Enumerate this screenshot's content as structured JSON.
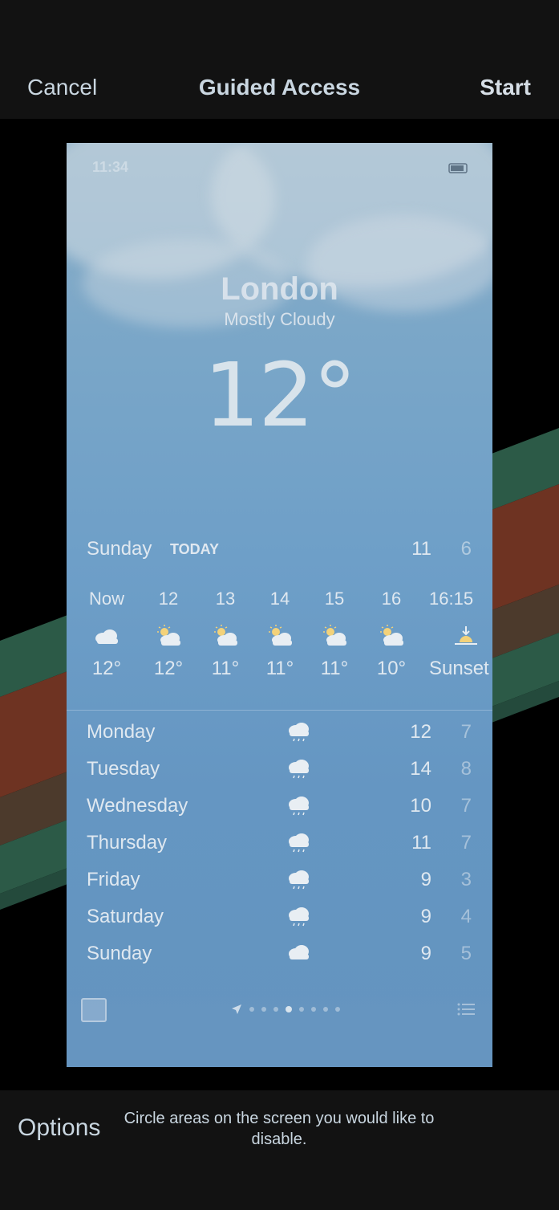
{
  "topbar": {
    "cancel": "Cancel",
    "title": "Guided Access",
    "start": "Start"
  },
  "weather": {
    "status_time": "11:34",
    "city": "London",
    "condition": "Mostly Cloudy",
    "temperature": "12°",
    "today": {
      "day": "Sunday",
      "tag": "TODAY",
      "high": "11",
      "low": "6"
    },
    "hourly": [
      {
        "time": "Now",
        "icon": "cloud-icon",
        "temp": "12°"
      },
      {
        "time": "12",
        "icon": "partly-sunny-icon",
        "temp": "12°"
      },
      {
        "time": "13",
        "icon": "partly-sunny-icon",
        "temp": "11°"
      },
      {
        "time": "14",
        "icon": "partly-sunny-icon",
        "temp": "11°"
      },
      {
        "time": "15",
        "icon": "partly-sunny-icon",
        "temp": "11°"
      },
      {
        "time": "16",
        "icon": "partly-sunny-icon",
        "temp": "10°"
      },
      {
        "time": "16:15",
        "icon": "sunset-icon",
        "temp": "Sunset"
      }
    ],
    "daily": [
      {
        "day": "Monday",
        "icon": "rain-icon",
        "high": "12",
        "low": "7"
      },
      {
        "day": "Tuesday",
        "icon": "rain-icon",
        "high": "14",
        "low": "8"
      },
      {
        "day": "Wednesday",
        "icon": "rain-icon",
        "high": "10",
        "low": "7"
      },
      {
        "day": "Thursday",
        "icon": "rain-icon",
        "high": "11",
        "low": "7"
      },
      {
        "day": "Friday",
        "icon": "rain-icon",
        "high": "9",
        "low": "3"
      },
      {
        "day": "Saturday",
        "icon": "rain-icon",
        "high": "9",
        "low": "4"
      },
      {
        "day": "Sunday",
        "icon": "cloud-icon",
        "high": "9",
        "low": "5"
      }
    ]
  },
  "optbar": {
    "options": "Options",
    "hint": "Circle areas on the screen you would like to disable."
  },
  "colors": {
    "bar_bg": "#121212",
    "stripe_green": "#2c5a47",
    "stripe_red": "#6e3322",
    "stripe_brown": "#4c3a2c"
  }
}
